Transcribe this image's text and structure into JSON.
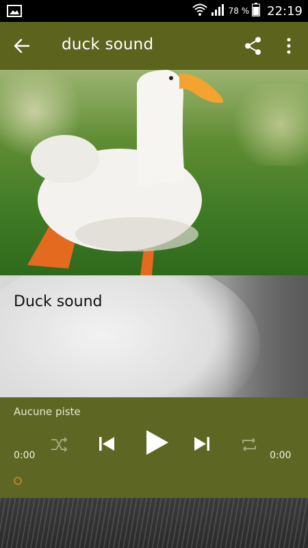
{
  "status_bar": {
    "battery_percent": "78 %",
    "time": "22:19",
    "icons": [
      "image-icon",
      "wifi-icon",
      "signal-icon",
      "battery-icon"
    ]
  },
  "app_bar": {
    "title": "duck sound",
    "icons": [
      "back-arrow-icon",
      "share-icon",
      "more-vert-icon"
    ]
  },
  "track_card": {
    "name": "Duck sound"
  },
  "player": {
    "current_track": "Aucune piste",
    "time_elapsed": "0:00",
    "time_total": "0:00",
    "icons": [
      "shuffle-icon",
      "skip-previous-icon",
      "play-icon",
      "skip-next-icon",
      "repeat-icon"
    ]
  },
  "colors": {
    "app_bar": "#5c631d",
    "player": "#5e6623",
    "seek_thumb": "#b8822e"
  }
}
